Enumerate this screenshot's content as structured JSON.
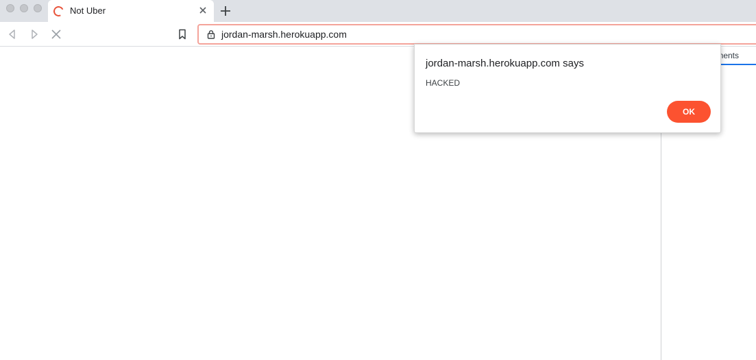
{
  "browser": {
    "tab": {
      "title": "Not Uber"
    },
    "address_bar": {
      "url": "jordan-marsh.herokuapp.com"
    }
  },
  "devtools": {
    "active_tab": "lements"
  },
  "alert_dialog": {
    "title": "jordan-marsh.herokuapp.com says",
    "message": "HACKED",
    "ok_label": "OK"
  },
  "colors": {
    "accent": "#fc5230",
    "omnibox_border": "#f4a39a",
    "devtools_tab_underline": "#1a73e8"
  },
  "icons": [
    "back-icon",
    "forward-icon",
    "stop-icon",
    "bookmark-icon",
    "lock-icon",
    "loading-spinner-icon",
    "close-icon",
    "plus-icon"
  ]
}
